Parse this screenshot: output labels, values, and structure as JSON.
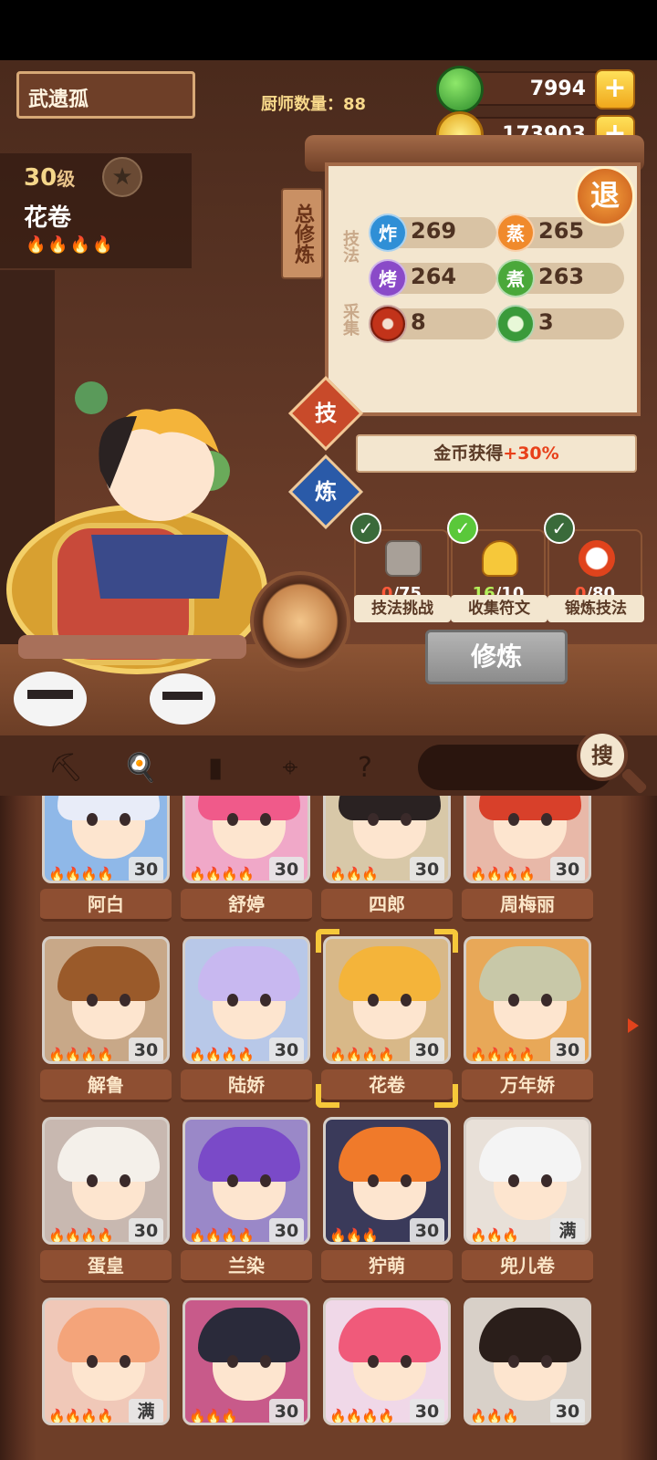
{
  "header": {
    "player_name": "武遗孤",
    "chef_count_label": "厨师数量：",
    "chef_count": "88"
  },
  "resources": [
    {
      "name": "jade",
      "value": "7994",
      "icon": "green-jade-icon",
      "color": "#3aa83a"
    },
    {
      "name": "coins",
      "value": "173903",
      "icon": "gold-coin-icon",
      "color": "#f2b91c"
    }
  ],
  "chef": {
    "level": "30",
    "level_unit": "级",
    "name": "花卷",
    "flames": "🔥🔥🔥🔥"
  },
  "training": {
    "tag": "总修炼",
    "section_skill": "技法",
    "section_gather": "采集",
    "stats": [
      {
        "label": "炸",
        "value": "269",
        "color": "#2f8fd6"
      },
      {
        "label": "蒸",
        "value": "265",
        "color": "#f08a2c"
      },
      {
        "label": "烤",
        "value": "264",
        "color": "#8a4ac8"
      },
      {
        "label": "煮",
        "value": "263",
        "color": "#4aa83a"
      },
      {
        "label": "",
        "value": "8",
        "color": "#c2331a",
        "icon": "meat-icon"
      },
      {
        "label": "",
        "value": "3",
        "color": "#3a9a3a",
        "icon": "vegetable-icon"
      }
    ],
    "exit_label": "退",
    "tab_skill": "技",
    "tab_refine": "炼",
    "gold_bonus_prefix": "金币获得",
    "gold_bonus_value": "+30%",
    "tasks": [
      {
        "progress": "0",
        "total": "/75",
        "label": "技法挑战",
        "icon": "treasure-chest-icon"
      },
      {
        "progress": "16",
        "total": "/10",
        "label": "收集符文",
        "icon": "rune-icon"
      },
      {
        "progress": "0",
        "total": "/80",
        "label": "锻炼技法",
        "icon": "alarm-clock-icon"
      }
    ],
    "train_button": "修炼"
  },
  "toolbar": {
    "search_label": "搜",
    "icons": [
      "shovel-icon",
      "wok-icon",
      "jar-icon",
      "map-pin-icon",
      "quest-map-icon"
    ]
  },
  "chefs": [
    {
      "name": "阿白",
      "level": "30",
      "flames": "🔥🔥🔥🔥",
      "hair": "#e8ecf8",
      "bg": "#8fb8e8"
    },
    {
      "name": "舒婷",
      "level": "30",
      "flames": "🔥🔥🔥🔥",
      "hair": "#f05a8a",
      "bg": "#f0a8c8"
    },
    {
      "name": "四郎",
      "level": "30",
      "flames": "🔥🔥🔥",
      "hair": "#2a2222",
      "bg": "#d8c8a8"
    },
    {
      "name": "周梅丽",
      "level": "30",
      "flames": "🔥🔥🔥🔥",
      "hair": "#d8402a",
      "bg": "#e8b8a8"
    },
    {
      "name": "解鲁",
      "level": "30",
      "flames": "🔥🔥🔥🔥",
      "hair": "#9a5a2a",
      "bg": "#c8a888"
    },
    {
      "name": "陆娇",
      "level": "30",
      "flames": "🔥🔥🔥🔥",
      "hair": "#c8b8f0",
      "bg": "#b8c8e8"
    },
    {
      "name": "花卷",
      "level": "30",
      "flames": "🔥🔥🔥🔥",
      "hair": "#f4b43a",
      "bg": "#d8b888"
    },
    {
      "name": "万年娇",
      "level": "30",
      "flames": "🔥🔥🔥🔥",
      "hair": "#c8c8a8",
      "bg": "#e8a858"
    },
    {
      "name": "蛋皇",
      "level": "30",
      "flames": "🔥🔥🔥🔥",
      "hair": "#f4f0ea",
      "bg": "#c8b8b0"
    },
    {
      "name": "兰染",
      "level": "30",
      "flames": "🔥🔥🔥🔥",
      "hair": "#7a4ac8",
      "bg": "#9a88c8"
    },
    {
      "name": "狞萌",
      "level": "30",
      "flames": "🔥🔥🔥",
      "hair": "#f07a2a",
      "bg": "#3a3a5a"
    },
    {
      "name": "兜儿卷",
      "level": "满",
      "flames": "🔥🔥🔥",
      "hair": "#f4f4f4",
      "bg": "#e8e0d8"
    },
    {
      "name": "",
      "level": "满",
      "flames": "🔥🔥🔥🔥",
      "hair": "#f4a47a",
      "bg": "#f0c8b8"
    },
    {
      "name": "",
      "level": "30",
      "flames": "🔥🔥🔥",
      "hair": "#2a2a3a",
      "bg": "#c85a8a"
    },
    {
      "name": "",
      "level": "30",
      "flames": "🔥🔥🔥🔥",
      "hair": "#f05a7a",
      "bg": "#f0d8e8"
    },
    {
      "name": "",
      "level": "30",
      "flames": "🔥🔥🔥",
      "hair": "#2a1e1a",
      "bg": "#d8d0c8"
    }
  ],
  "selected_chef": "花卷"
}
